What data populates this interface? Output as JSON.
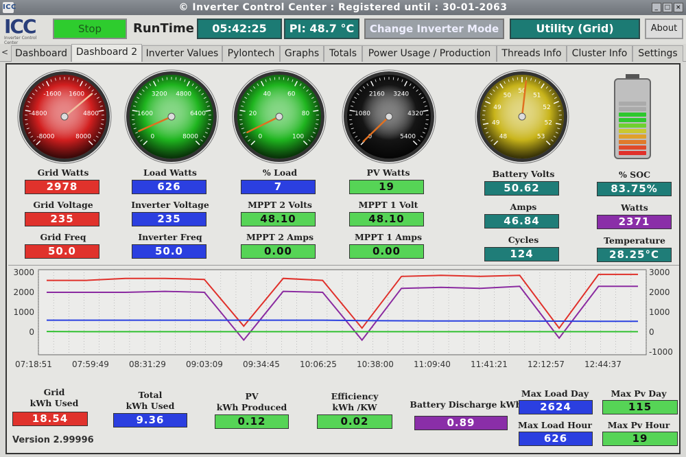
{
  "window": {
    "title": "© Inverter Control Center : Registered until : 30-01-2063",
    "icon_label": "ICC"
  },
  "toolbar": {
    "logo_text": "ICC",
    "logo_sub": "Inverter Control Center",
    "stop_label": "Stop",
    "runtime_label": "RunTime",
    "runtime_value": "05:42:25",
    "pi_temp": "PI: 48.7 °C",
    "mode_label": "Change Inverter Mode",
    "grid_label": "Utility (Grid)",
    "about_label": "About"
  },
  "tabs": [
    "Dashboard",
    "Dashboard 2",
    "Inverter Values",
    "Pylontech",
    "Graphs",
    "Totals",
    "Power Usage / Production",
    "Threads Info",
    "Cluster Info",
    "Settings"
  ],
  "active_tab": "Dashboard 2",
  "gauges": [
    {
      "name": "grid-watts",
      "face": "#d21f1f",
      "ticks": [
        "-8000",
        "-4800",
        "-1600",
        "1600",
        "4800",
        "8000"
      ],
      "min": -8000,
      "max": 8000,
      "value": 2978,
      "needle": "#f0c0a0"
    },
    {
      "name": "load-watts",
      "face": "#1fb51f",
      "ticks": [
        "0",
        "1600",
        "3200",
        "4800",
        "6400",
        "8000"
      ],
      "min": 0,
      "max": 8000,
      "value": 626,
      "needle": "#e07020"
    },
    {
      "name": "percent-load",
      "face": "#1fb51f",
      "ticks": [
        "0",
        "20",
        "40",
        "60",
        "80",
        "100"
      ],
      "min": 0,
      "max": 100,
      "value": 7,
      "needle": "#e07020"
    },
    {
      "name": "pv-watts",
      "face": "#151515",
      "ticks": [
        "0",
        "1080",
        "2160",
        "3240",
        "4320",
        "5400"
      ],
      "min": 0,
      "max": 5400,
      "value": 19,
      "needle": "#e07020"
    },
    {
      "name": "battery-volts",
      "face": "#c8b41a",
      "ticks": [
        "48",
        "49",
        "49",
        "50",
        "50",
        "51",
        "52",
        "52",
        "53"
      ],
      "min": 48,
      "max": 53,
      "value": 50.62,
      "needle": "#e07020"
    }
  ],
  "battery": {
    "soc": 83.75,
    "label": "% SOC",
    "soc_text": "83.75%"
  },
  "readings": {
    "grid_watts_label": "Grid Watts",
    "grid_watts": "2978",
    "grid_voltage_label": "Grid Voltage",
    "grid_voltage": "235",
    "grid_freq_label": "Grid Freq",
    "grid_freq": "50.0",
    "load_watts_label": "Load Watts",
    "load_watts": "626",
    "inv_voltage_label": "Inverter Voltage",
    "inv_voltage": "235",
    "inv_freq_label": "Inverter Freq",
    "inv_freq": "50.0",
    "load_pct_label": "% Load",
    "load_pct": "7",
    "mppt2_volts_label": "MPPT 2 Volts",
    "mppt2_volts": "48.10",
    "mppt2_amps_label": "MPPT 2 Amps",
    "mppt2_amps": "0.00",
    "pv_watts_label": "PV Watts",
    "pv_watts": "19",
    "mppt1_volt_label": "MPPT 1 Volt",
    "mppt1_volt": "48.10",
    "mppt1_amps_label": "MPPT 1 Amps",
    "mppt1_amps": "0.00",
    "batt_volts_label": "Battery Volts",
    "batt_volts": "50.62",
    "amps_label": "Amps",
    "amps": "46.84",
    "cycles_label": "Cycles",
    "cycles": "124",
    "watts_label": "Watts",
    "watts": "2371",
    "temp_label": "Temperature",
    "temp": "28.25°C"
  },
  "totals": {
    "grid_kwh_label_1": "Grid",
    "grid_kwh_label_2": "kWh Used",
    "grid_kwh": "18.54",
    "total_kwh_label_1": "Total",
    "total_kwh_label_2": "kWh Used",
    "total_kwh": "9.36",
    "pv_kwh_label_1": "PV",
    "pv_kwh_label_2": "kWh Produced",
    "pv_kwh": "0.12",
    "eff_label_1": "Efficiency",
    "eff_label_2": "kWh /KW",
    "eff": "0.02",
    "batt_dis_label": "Battery Discharge kWh",
    "batt_dis": "0.89",
    "max_load_day_label": "Max Load Day",
    "max_load_day": "2624",
    "max_load_hour_label": "Max Load Hour",
    "max_load_hour": "626",
    "max_pv_day_label": "Max Pv Day",
    "max_pv_day": "115",
    "max_pv_hour_label": "Max Pv Hour",
    "max_pv_hour": "19"
  },
  "version": "Version 2.99996",
  "chart_data": {
    "type": "line",
    "x_ticks": [
      "07:18:51",
      "07:59:49",
      "08:31:29",
      "09:03:09",
      "09:34:45",
      "10:06:25",
      "10:38:00",
      "11:09:40",
      "11:41:21",
      "12:12:57",
      "12:44:37"
    ],
    "ylim": [
      -1000,
      3000
    ],
    "y_ticks_left": [
      "3000",
      "2000",
      "1000",
      "0"
    ],
    "y_ticks_right": [
      "3000",
      "2000",
      "1000",
      "0",
      "-1000"
    ],
    "series": [
      {
        "color": "#e0302a",
        "values": [
          2600,
          2600,
          2700,
          2700,
          2650,
          300,
          2700,
          2600,
          200,
          2800,
          2850,
          2800,
          2850,
          200,
          2900,
          2900
        ]
      },
      {
        "color": "#8a2aa0",
        "values": [
          2000,
          2000,
          2000,
          2050,
          2000,
          -400,
          2050,
          2000,
          -400,
          2200,
          2250,
          2200,
          2300,
          -300,
          2300,
          2300
        ]
      },
      {
        "color": "#2a40e0",
        "values": [
          600,
          600,
          600,
          600,
          600,
          600,
          600,
          600,
          580,
          570,
          560,
          560,
          560,
          550,
          540,
          540
        ]
      },
      {
        "color": "#30c030",
        "values": [
          30,
          20,
          20,
          20,
          20,
          20,
          20,
          20,
          20,
          20,
          20,
          20,
          20,
          20,
          20,
          20
        ]
      }
    ]
  }
}
